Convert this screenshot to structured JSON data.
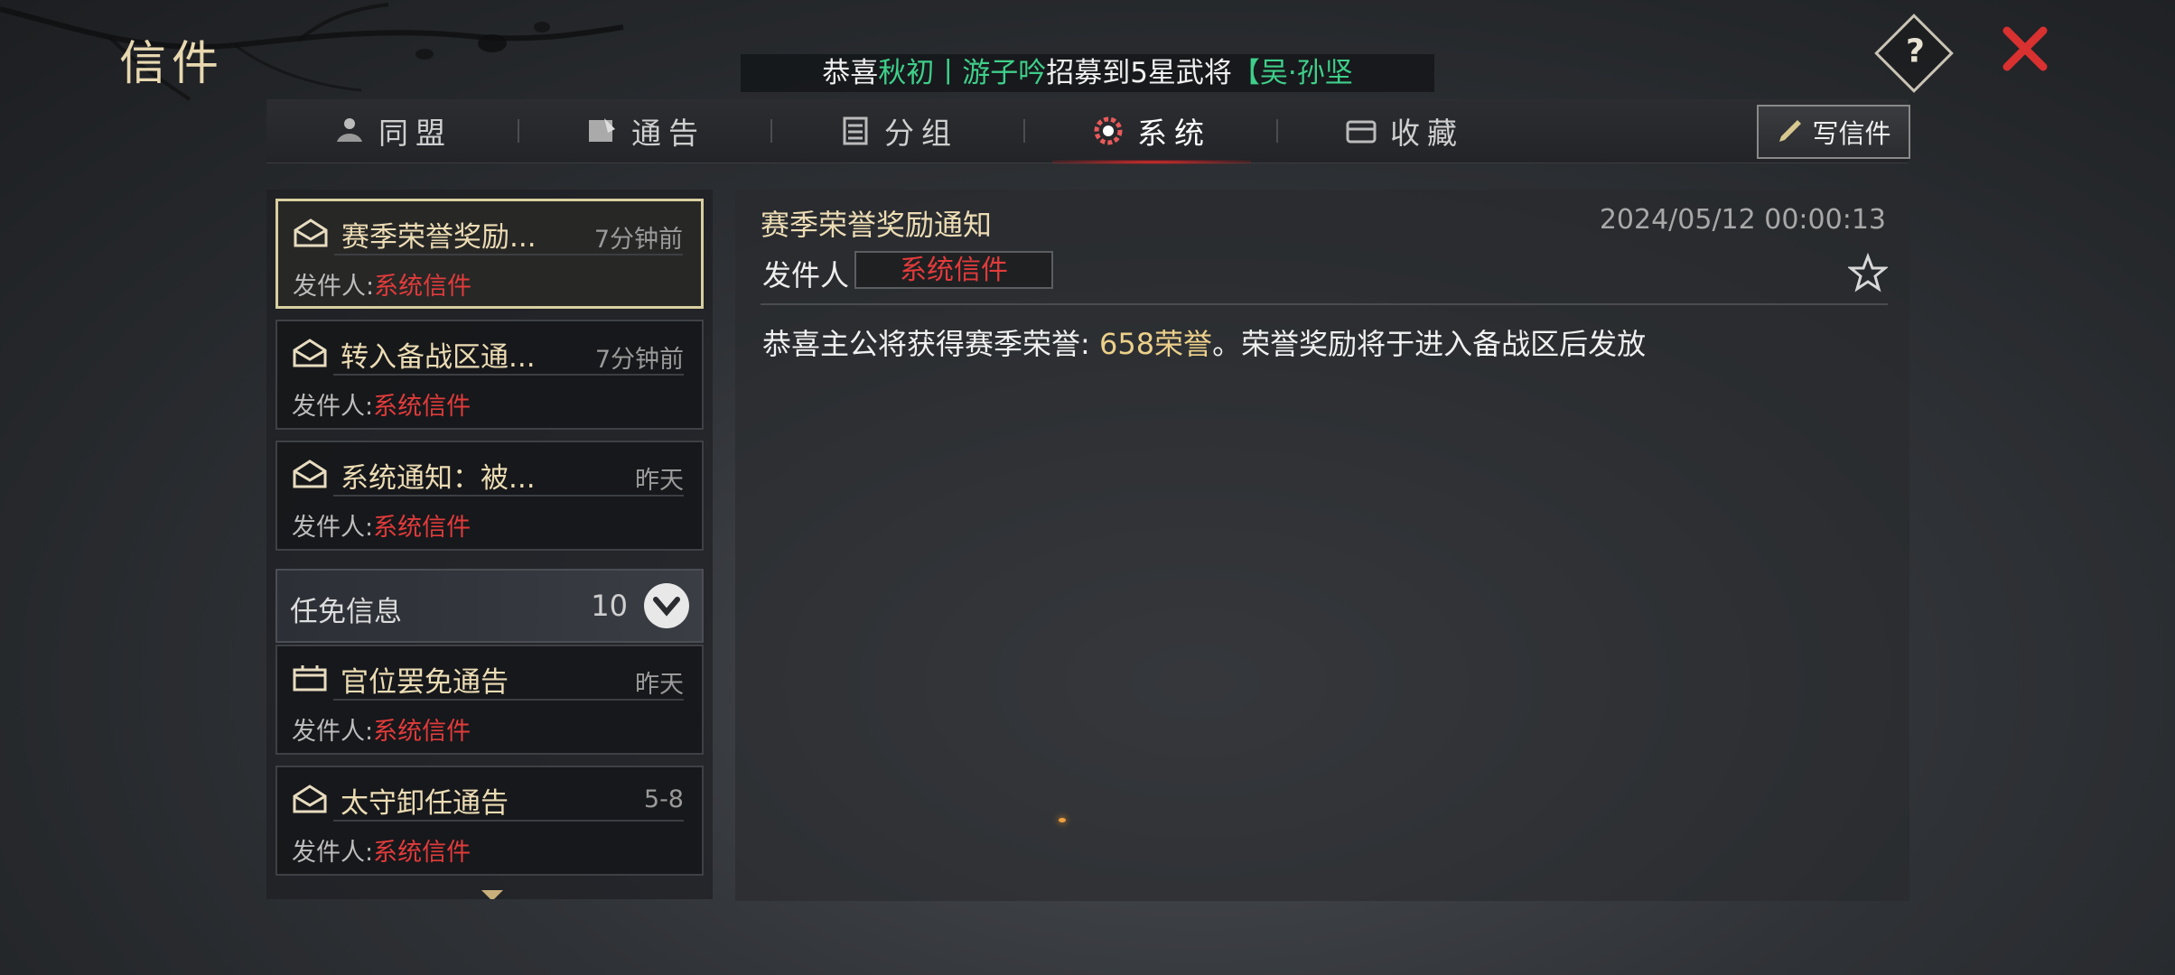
{
  "header": {
    "title": "信件",
    "ticker": {
      "prefix": "恭喜",
      "player": "秋初丨游子吟",
      "middle": "招募到5星武将",
      "hero": "【吴·孙坚"
    },
    "help_label": "?"
  },
  "tabs": [
    {
      "label": "同盟",
      "icon": "alliance-icon"
    },
    {
      "label": "通告",
      "icon": "announcement-icon"
    },
    {
      "label": "分组",
      "icon": "group-icon"
    },
    {
      "label": "系统",
      "icon": "system-gear-icon",
      "active": true
    },
    {
      "label": "收藏",
      "icon": "favorite-box-icon"
    }
  ],
  "write_button": "写信件",
  "mail_list": {
    "items": [
      {
        "subject": "赛季荣誉奖励...",
        "time": "7分钟前",
        "from_label": "发件人:",
        "from": "系统信件",
        "icon": "envelope-icon",
        "selected": true
      },
      {
        "subject": "转入备战区通...",
        "time": "7分钟前",
        "from_label": "发件人:",
        "from": "系统信件",
        "icon": "envelope-icon"
      },
      {
        "subject": "系统通知：被...",
        "time": "昨天",
        "from_label": "发件人:",
        "from": "系统信件",
        "icon": "envelope-icon"
      }
    ],
    "group": {
      "label": "任免信息",
      "count": "10"
    },
    "group_items": [
      {
        "subject": "官位罢免通告",
        "time": "昨天",
        "from_label": "发件人:",
        "from": "系统信件",
        "icon": "notice-board-icon"
      },
      {
        "subject": "太守卸任通告",
        "time": "5-8",
        "from_label": "发件人:",
        "from": "系统信件",
        "icon": "envelope-icon"
      }
    ]
  },
  "detail": {
    "title": "赛季荣誉奖励通知",
    "date": "2024/05/12 00:00:13",
    "sender_label": "发件人",
    "sender": "系统信件",
    "body_prefix": "恭喜主公将获得赛季荣誉: ",
    "body_highlight": "658荣誉",
    "body_suffix": "。荣誉奖励将于进入备战区后发放"
  },
  "colors": {
    "gold_text": "#ecdcb4",
    "sender_red": "#e23b3b",
    "ticker_green": "#3fcf8a",
    "close_red": "#d93030",
    "active_tab_glow": "#e02a2a"
  }
}
